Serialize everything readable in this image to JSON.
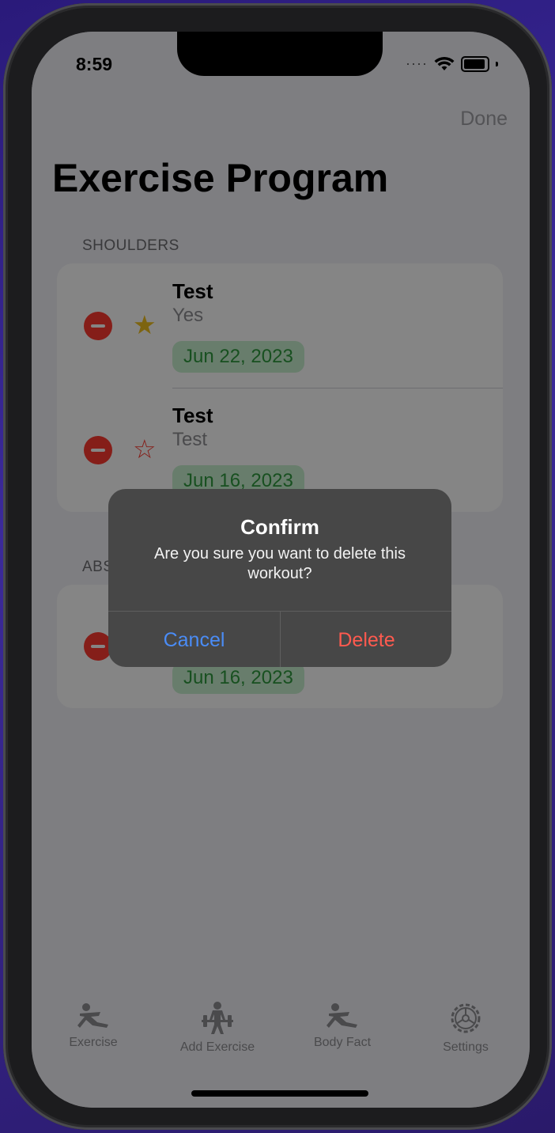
{
  "status_bar": {
    "time": "8:59",
    "signal": "····"
  },
  "nav": {
    "done_label": "Done",
    "title": "Exercise Program"
  },
  "sections": [
    {
      "header": "SHOULDERS",
      "rows": [
        {
          "title": "Test",
          "subtitle": "Yes",
          "date": "Jun 22, 2023",
          "favorite": true
        },
        {
          "title": "Test",
          "subtitle": "Test",
          "date": "Jun 16, 2023",
          "favorite": false
        }
      ]
    },
    {
      "header": "ABS",
      "rows": [
        {
          "title": "",
          "subtitle": "",
          "date": "Jun 16, 2023",
          "favorite": false
        }
      ]
    }
  ],
  "alert": {
    "title": "Confirm",
    "message": "Are you sure you want to delete this workout?",
    "cancel_label": "Cancel",
    "delete_label": "Delete"
  },
  "tabs": [
    {
      "label": "Exercise",
      "icon": "figure-exercise-icon"
    },
    {
      "label": "Add Exercise",
      "icon": "weightlifter-icon"
    },
    {
      "label": "Body Fact",
      "icon": "figure-exercise-icon"
    },
    {
      "label": "Settings",
      "icon": "gear-icon"
    }
  ],
  "colors": {
    "destructive": "#ff3b30",
    "favorite": "#f0c020",
    "date_badge_bg": "#c8efcf",
    "date_badge_text": "#2f9a3f",
    "alert_cancel": "#4a8cf6",
    "alert_delete": "#ff5a4f"
  }
}
